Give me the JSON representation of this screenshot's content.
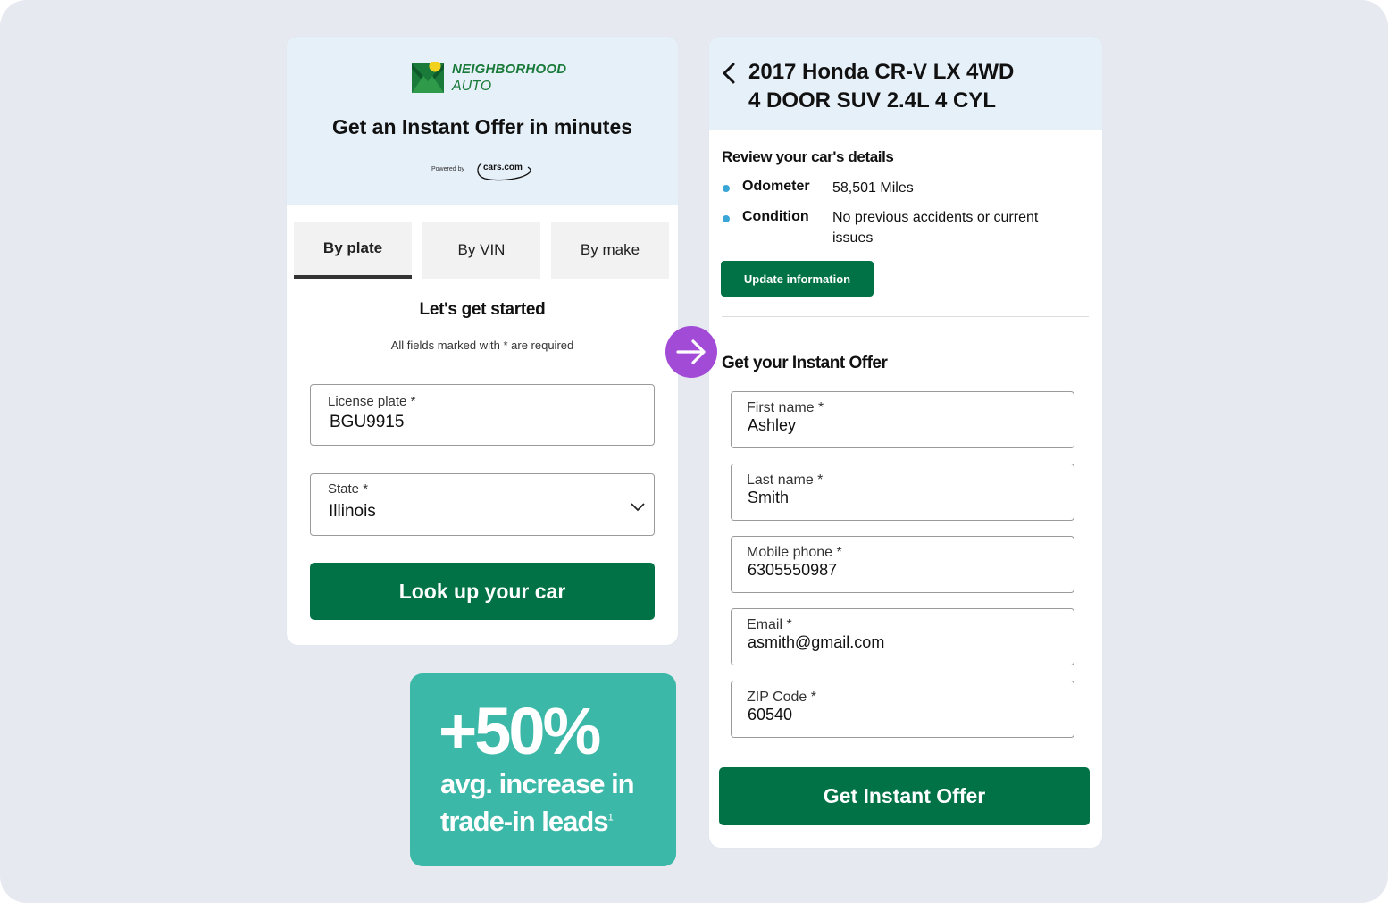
{
  "colors": {
    "background": "#e6e9f0",
    "header_bg": "#e6f0f9",
    "primary_green": "#007246",
    "stat_teal": "#3cb8a8",
    "arrow_purple": "#a24bd6",
    "bullet_blue": "#3aa6d8"
  },
  "left": {
    "logo": {
      "icon": "neighborhood-auto-logo-icon",
      "line1": "NEIGHBORHOOD",
      "line2": "AUTO"
    },
    "title": "Get an Instant Offer in minutes",
    "powered_by": "Powered by",
    "partner_logo_text": "cars.com",
    "tabs": [
      {
        "label": "By plate",
        "active": true
      },
      {
        "label": "By VIN",
        "active": false
      },
      {
        "label": "By make",
        "active": false
      }
    ],
    "section_title": "Let's get started",
    "required_note": "All fields marked with * are required",
    "license_plate": {
      "label": "License plate *",
      "value": "BGU9915"
    },
    "state": {
      "label": "State *",
      "value": "Illinois",
      "icon": "chevron-down-icon"
    },
    "lookup_button": "Look up your car"
  },
  "stat": {
    "value": "+50%",
    "line1": "avg. increase in",
    "line2": "trade-in leads",
    "footnote": "1"
  },
  "arrow_icon": "arrow-right-icon",
  "right": {
    "back_icon": "chevron-left-icon",
    "car_title_line1": "2017 Honda CR-V LX 4WD",
    "car_title_line2": "4 DOOR SUV 2.4L 4 CYL",
    "review_title": "Review your car's details",
    "details": [
      {
        "label": "Odometer",
        "value": "58,501 Miles"
      },
      {
        "label": "Condition",
        "value": "No previous accidents or current issues"
      }
    ],
    "update_button": "Update information",
    "offer_title": "Get your Instant Offer",
    "fields": [
      {
        "label": "First name *",
        "value": "Ashley"
      },
      {
        "label": "Last name *",
        "value": "Smith"
      },
      {
        "label": "Mobile phone *",
        "value": "6305550987"
      },
      {
        "label": "Email *",
        "value": "asmith@gmail.com"
      },
      {
        "label": "ZIP Code *",
        "value": "60540"
      }
    ],
    "submit_button": "Get Instant Offer"
  }
}
